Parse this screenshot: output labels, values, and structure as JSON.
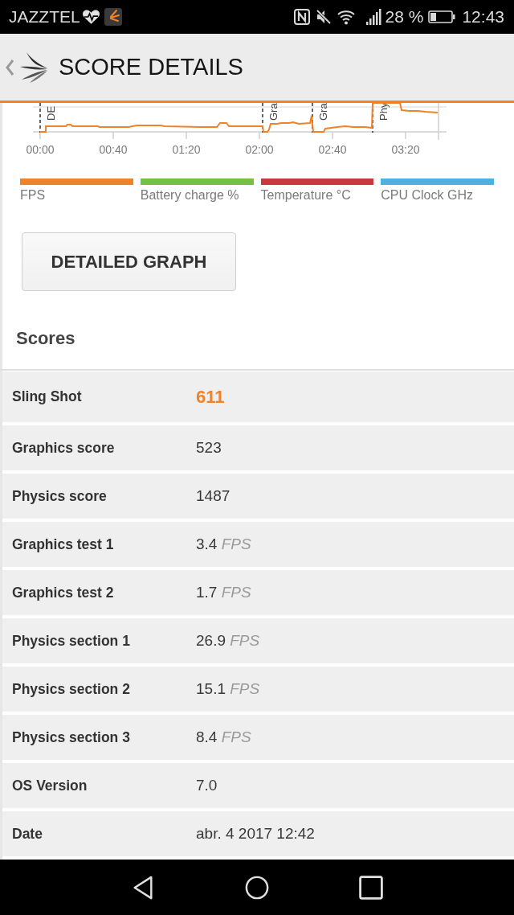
{
  "status_bar": {
    "carrier": "JAZZTEL",
    "battery_text": "28 %",
    "time": "12:43"
  },
  "app_bar": {
    "title": "SCORE DETAILS"
  },
  "graph": {
    "event_labels": [
      "DE",
      "Gra",
      "Gra",
      "Phy"
    ],
    "time_ticks": [
      "00:00",
      "00:40",
      "01:20",
      "02:00",
      "02:40",
      "03:20"
    ],
    "legend": [
      {
        "label": "FPS",
        "color": "#f0832a"
      },
      {
        "label": "Battery charge %",
        "color": "#78c043"
      },
      {
        "label": "Temperature °C",
        "color": "#c9383d"
      },
      {
        "label": "CPU Clock GHz",
        "color": "#4fb0e3"
      }
    ]
  },
  "detailed_graph_button": {
    "label": "DETAILED GRAPH"
  },
  "scores": {
    "heading": "Scores",
    "rows": [
      {
        "label": "Sling Shot",
        "value": "611",
        "kind": "overall"
      },
      {
        "label": "Graphics score",
        "value": "523",
        "kind": "plain"
      },
      {
        "label": "Physics score",
        "value": "1487",
        "kind": "plain"
      },
      {
        "label": "Graphics test 1",
        "value": "3.4",
        "unit": "FPS",
        "kind": "plain"
      },
      {
        "label": "Graphics test 2",
        "value": "1.7",
        "unit": "FPS",
        "kind": "plain"
      },
      {
        "label": "Physics section 1",
        "value": "26.9",
        "unit": "FPS",
        "kind": "plain"
      },
      {
        "label": "Physics section 2",
        "value": "15.1",
        "unit": "FPS",
        "kind": "plain"
      },
      {
        "label": "Physics section 3",
        "value": "8.4",
        "unit": "FPS",
        "kind": "plain"
      },
      {
        "label": "OS Version",
        "value": "7.0",
        "kind": "plain"
      },
      {
        "label": "Date",
        "value": "abr. 4 2017 12:42",
        "kind": "plain"
      }
    ]
  }
}
